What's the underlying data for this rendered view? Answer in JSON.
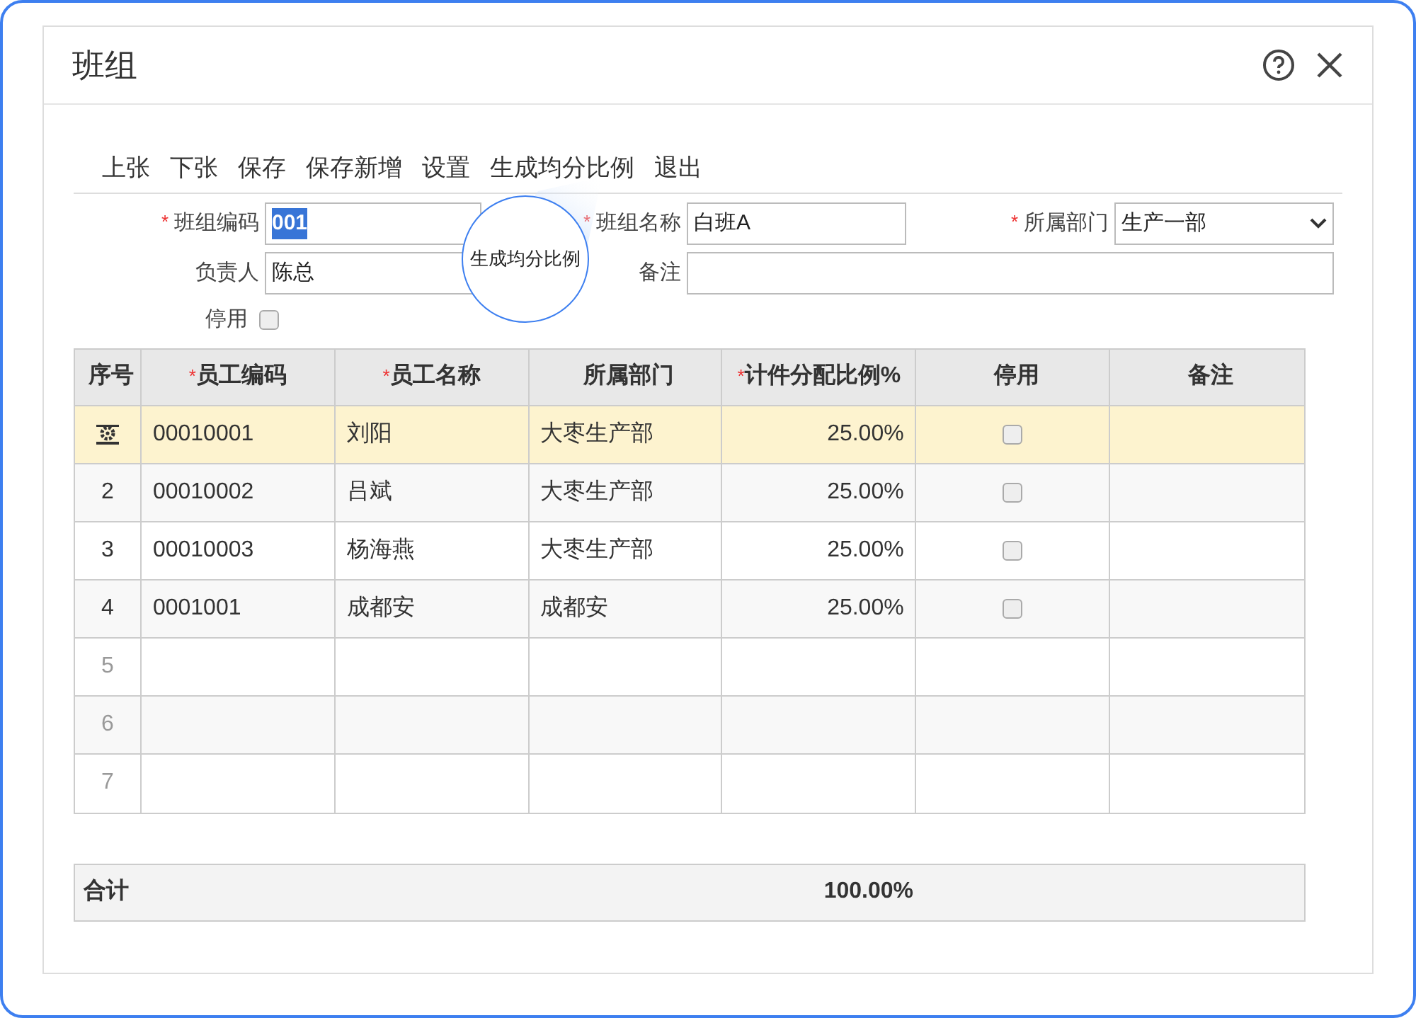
{
  "window": {
    "title": "班组"
  },
  "toolbar": [
    "上张",
    "下张",
    "保存",
    "保存新增",
    "设置",
    "生成均分比例",
    "退出"
  ],
  "callout": {
    "text": "生成均分比例"
  },
  "required_mark": "*",
  "form": {
    "code": {
      "label": "班组编码",
      "required": true,
      "value": "001"
    },
    "name": {
      "label": "班组名称",
      "required": true,
      "value": "白班A"
    },
    "department": {
      "label": "所属部门",
      "required": true,
      "value": "生产一部"
    },
    "leader": {
      "label": "负责人",
      "required": false,
      "value": "陈总"
    },
    "remark": {
      "label": "备注",
      "required": false
    },
    "disabled": {
      "label": "停用",
      "checked": false
    }
  },
  "table": {
    "columns": [
      {
        "label": "序号",
        "required": false
      },
      {
        "label": "员工编码",
        "required": true
      },
      {
        "label": "员工名称",
        "required": true
      },
      {
        "label": "所属部门",
        "required": false
      },
      {
        "label": "计件分配比例%",
        "required": true
      },
      {
        "label": "停用",
        "required": false
      },
      {
        "label": "备注",
        "required": false
      }
    ],
    "rows": [
      {
        "kind": "filled",
        "selected": true,
        "cells": [
          "00010001",
          "刘阳",
          "大枣生产部",
          "25.00%"
        ],
        "disabled": false
      },
      {
        "kind": "filled",
        "selected": false,
        "seq": "2",
        "cells": [
          "00010002",
          "吕斌",
          "大枣生产部",
          "25.00%"
        ],
        "disabled": false
      },
      {
        "kind": "filled",
        "selected": false,
        "seq": "3",
        "cells": [
          "00010003",
          "杨海燕",
          "大枣生产部",
          "25.00%"
        ],
        "disabled": false
      },
      {
        "kind": "filled",
        "selected": false,
        "seq": "4",
        "cells": [
          "0001001",
          "成都安",
          "成都安",
          "25.00%"
        ],
        "disabled": false
      },
      {
        "kind": "empty",
        "selected": false,
        "seq": "5"
      },
      {
        "kind": "empty",
        "selected": false,
        "seq": "6"
      },
      {
        "kind": "empty",
        "selected": false,
        "seq": "7"
      }
    ]
  },
  "total": {
    "label": "合计",
    "value": "100.00%"
  }
}
